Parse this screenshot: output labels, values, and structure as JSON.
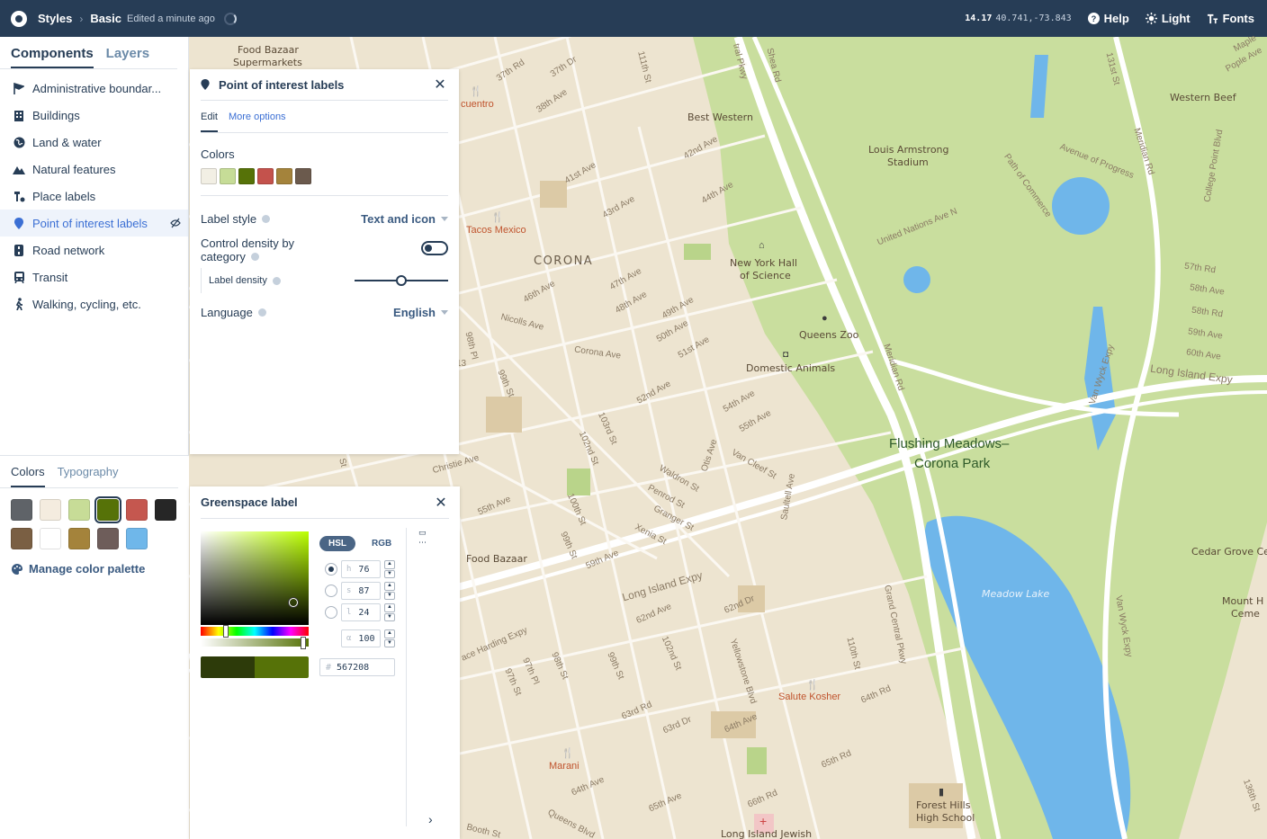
{
  "topbar": {
    "crumb_styles": "Styles",
    "crumb_basic": "Basic",
    "edited": "Edited a minute ago",
    "zoom": "14.17",
    "latlng": "40.741,-73.843",
    "help": "Help",
    "light": "Light",
    "fonts": "Fonts"
  },
  "left": {
    "tab_components": "Components",
    "tab_layers": "Layers",
    "components": [
      {
        "label": "Administrative boundar...",
        "icon": "flag-icon"
      },
      {
        "label": "Buildings",
        "icon": "building-icon"
      },
      {
        "label": "Land & water",
        "icon": "globe-icon"
      },
      {
        "label": "Natural features",
        "icon": "mountain-icon"
      },
      {
        "label": "Place labels",
        "icon": "place-label-icon"
      },
      {
        "label": "Point of interest labels",
        "icon": "pin-icon"
      },
      {
        "label": "Road network",
        "icon": "road-icon"
      },
      {
        "label": "Transit",
        "icon": "train-icon"
      },
      {
        "label": "Walking, cycling, etc.",
        "icon": "walk-icon"
      }
    ],
    "subtab_colors": "Colors",
    "subtab_typography": "Typography",
    "palette": [
      "#5f6368",
      "#f4ecdf",
      "#c7dc97",
      "#567208",
      "#c5574f",
      "#262626",
      "#7a5f43",
      "#ffffff",
      "#a4833b",
      "#6e5d5a",
      "#6fb7ea"
    ],
    "manage": "Manage color palette"
  },
  "poi_panel": {
    "title": "Point of interest labels",
    "tab_edit": "Edit",
    "tab_more": "More options",
    "colors_title": "Colors",
    "swatches": [
      "#f2efe4",
      "#c6dc97",
      "#567208",
      "#c4524c",
      "#a4833b",
      "#6b5a4d"
    ],
    "label_style": "Label style",
    "label_style_value": "Text and icon",
    "control_density_line1": "Control density by",
    "control_density_line2": "category",
    "label_density": "Label density",
    "label_density_level": 0.5,
    "language": "Language",
    "language_value": "English"
  },
  "greenspace": {
    "title": "Greenspace label",
    "mode_hsl": "HSL",
    "mode_rgb": "RGB",
    "h_label": "h",
    "h_value": "76",
    "s_label": "s",
    "s_value": "87",
    "l_label": "l",
    "l_value": "24",
    "a_label": "α",
    "a_value": "100",
    "hex_label": "#",
    "hex_value": "567208",
    "preview_old": "#2d3b0a",
    "preview_new": "#567208"
  },
  "map": {
    "labels": {
      "corona": "CORONA",
      "food_bazaar_supermarket_1": "Food Bazaar",
      "food_bazaar_supermarket_2": "Supermarkets",
      "best_western": "Best Western",
      "tacos_mexico": "Tacos Mexico",
      "cuentro": "cuentro",
      "louis_1": "Louis Armstrong",
      "louis_2": "Stadium",
      "nyhall_1": "New York Hall",
      "nyhall_2": "of Science",
      "queens_zoo": "Queens Zoo",
      "domestic_animals": "Domestic Animals",
      "flushing_1": "Flushing Meadows–",
      "flushing_2": "Corona Park",
      "meadow_lake": "Meadow Lake",
      "food_bazaar": "Food Bazaar",
      "salute_kosher": "Salute Kosher",
      "marani": "Marani",
      "forest_hills_1": "Forest Hills",
      "forest_hills_2": "High School",
      "long_island_jewish": "Long Island Jewish",
      "western_beef": "Western Beef",
      "cedar_grove": "Cedar Grove Cem",
      "mount_1": "Mount H",
      "mount_2": "Ceme",
      "long_island_expy": "Long Island Expy",
      "long_island_expy_2": "Long Island Expy",
      "van_wyck": "Van Wyck Expy",
      "van_wyck_2": "Van Wyck Expy",
      "grand_central": "Grand Central Pkwy",
      "united_nations": "United Nations Ave N",
      "avenue_progress": "Avenue of Progress",
      "path_commerce": "Path of Commerce",
      "college_point": "College Point Blvd",
      "meridian_rd": "Meridian Rd",
      "meridian_rd_2": "Meridian Rd",
      "christie_ave": "Christie Ave",
      "horace_harding": "ace Harding Expy",
      "yellowstone": "Yellowstone Blvd",
      "queens_blvd": "Queens Blvd",
      "corona_ave": "Corona Ave",
      "nicolls_ave": "Nicolls Ave",
      "waldron_st": "Waldron St",
      "penrod_st": "Penrod St",
      "granger_st": "Granger St",
      "xenia_st": "Xenia St",
      "otis_ave": "Otis Ave",
      "van_cleef": "Van Cleef St",
      "saultell": "Saultell Ave",
      "st_37th_rd": "37th Rd",
      "st_37th_dr": "37th Dr",
      "st_38th": "38th Ave",
      "st_41st": "41st Ave",
      "st_42nd": "42nd Ave",
      "st_43rd": "43rd Ave",
      "st_44th": "44th Ave",
      "st_46th": "46th Ave",
      "st_47th": "47th Ave",
      "st_48th": "48th Ave",
      "st_49th": "49th Ave",
      "st_50th": "50th Ave",
      "st_51st": "51st Ave",
      "st_52nd": "52nd Ave",
      "st_54th": "54th Ave",
      "st_55th": "55th Ave",
      "st_55th_2": "55th Ave",
      "st_59th": "59th Ave",
      "st_62nd": "62nd Ave",
      "st_62nd_dr": "62nd Dr",
      "st_63rd": "63rd Rd",
      "st_63rd_dr": "63rd Dr",
      "st_64th": "64th Ave",
      "st_64th_2": "64th Ave",
      "st_64th_rd": "64th Rd",
      "st_65th": "65th Ave",
      "st_65th_rd": "65th Rd",
      "st_66th": "66th Rd",
      "st_57th": "57th Rd",
      "st_58th": "58th Ave",
      "st_58th_rd": "58th Rd",
      "st_59th_2": "59th Ave",
      "st_60th": "60th Ave",
      "st_111th": "111th St",
      "st_103rd": "103rd St",
      "st_102nd": "102nd St",
      "st_100th": "100th St",
      "st_99th": "99th St",
      "st_99th_2": "99th St",
      "st_99th_3": "99th St",
      "st_98th": "98th St",
      "st_97th": "97th Pl",
      "st_97th_st": "97th St",
      "st_102nd_2": "102nd St",
      "st_110th": "110th St",
      "st_131st": "131st St",
      "st_shea": "Shea Rd",
      "st_tral": "tral Pkwy",
      "st_booth": "Booth St",
      "st_98th_pl": "98th Pl",
      "st_136th": "136th St",
      "pople_ave": "Pople Ave",
      "maple": "Maple",
      "st_13": "13",
      "st_st": "St"
    }
  }
}
